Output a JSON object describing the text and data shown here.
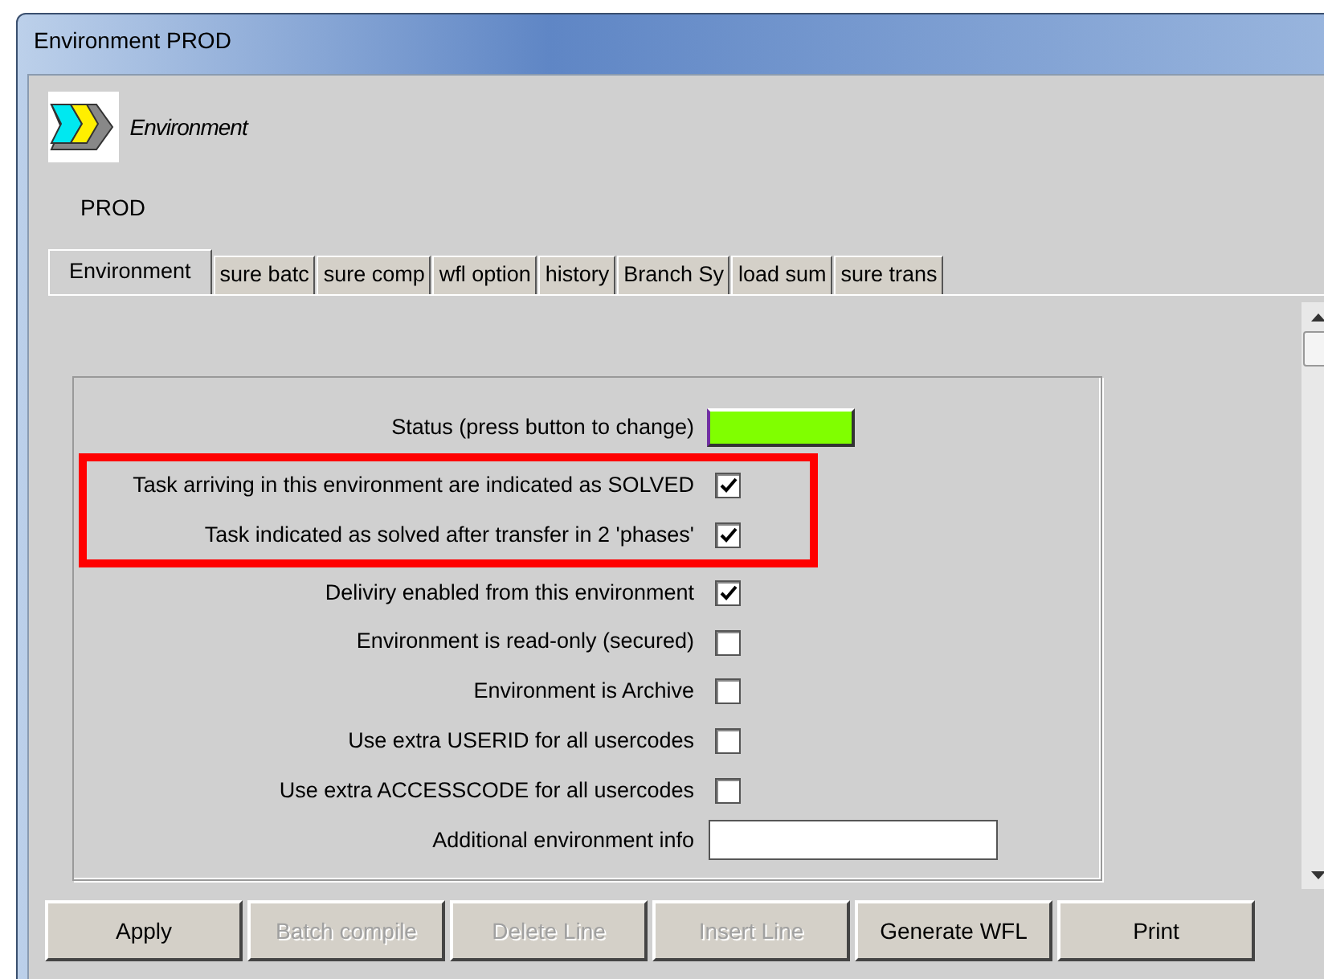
{
  "window": {
    "title": "Environment PROD"
  },
  "header": {
    "label": "Environment",
    "name": "PROD"
  },
  "tabs": [
    {
      "label": "Environment",
      "selected": true
    },
    {
      "label": "sure batc",
      "selected": false
    },
    {
      "label": "sure comp",
      "selected": false
    },
    {
      "label": "wfl option",
      "selected": false
    },
    {
      "label": "history",
      "selected": false
    },
    {
      "label": "Branch Sy",
      "selected": false
    },
    {
      "label": "load sum",
      "selected": false
    },
    {
      "label": "sure trans",
      "selected": false
    }
  ],
  "fields": [
    {
      "kind": "status",
      "label": "Status (press button to change)",
      "color": "#80ff00",
      "highlighted": false
    },
    {
      "kind": "checkbox",
      "label": "Task arriving in this environment are indicated as SOLVED",
      "checked": true,
      "highlighted": true
    },
    {
      "kind": "checkbox",
      "label": "Task indicated as solved after transfer in 2 'phases'",
      "checked": true,
      "highlighted": true
    },
    {
      "kind": "checkbox",
      "label": "Deliviry enabled from this environment",
      "checked": true,
      "highlighted": false
    },
    {
      "kind": "checkbox",
      "label": "Environment is read-only (secured)",
      "checked": false,
      "highlighted": false
    },
    {
      "kind": "checkbox",
      "label": "Environment is Archive",
      "checked": false,
      "highlighted": false
    },
    {
      "kind": "checkbox",
      "label": "Use extra USERID for all usercodes",
      "checked": false,
      "highlighted": false
    },
    {
      "kind": "checkbox",
      "label": "Use extra ACCESSCODE for all usercodes",
      "checked": false,
      "highlighted": false
    },
    {
      "kind": "text",
      "label": "Additional environment info",
      "highlighted": false
    }
  ],
  "buttons": [
    {
      "label": "Apply",
      "disabled": false
    },
    {
      "label": "Batch compile",
      "disabled": true
    },
    {
      "label": "Delete Line",
      "disabled": true
    },
    {
      "label": "Insert Line",
      "disabled": true
    },
    {
      "label": "Generate WFL",
      "disabled": false
    },
    {
      "label": "Print",
      "disabled": false
    }
  ]
}
